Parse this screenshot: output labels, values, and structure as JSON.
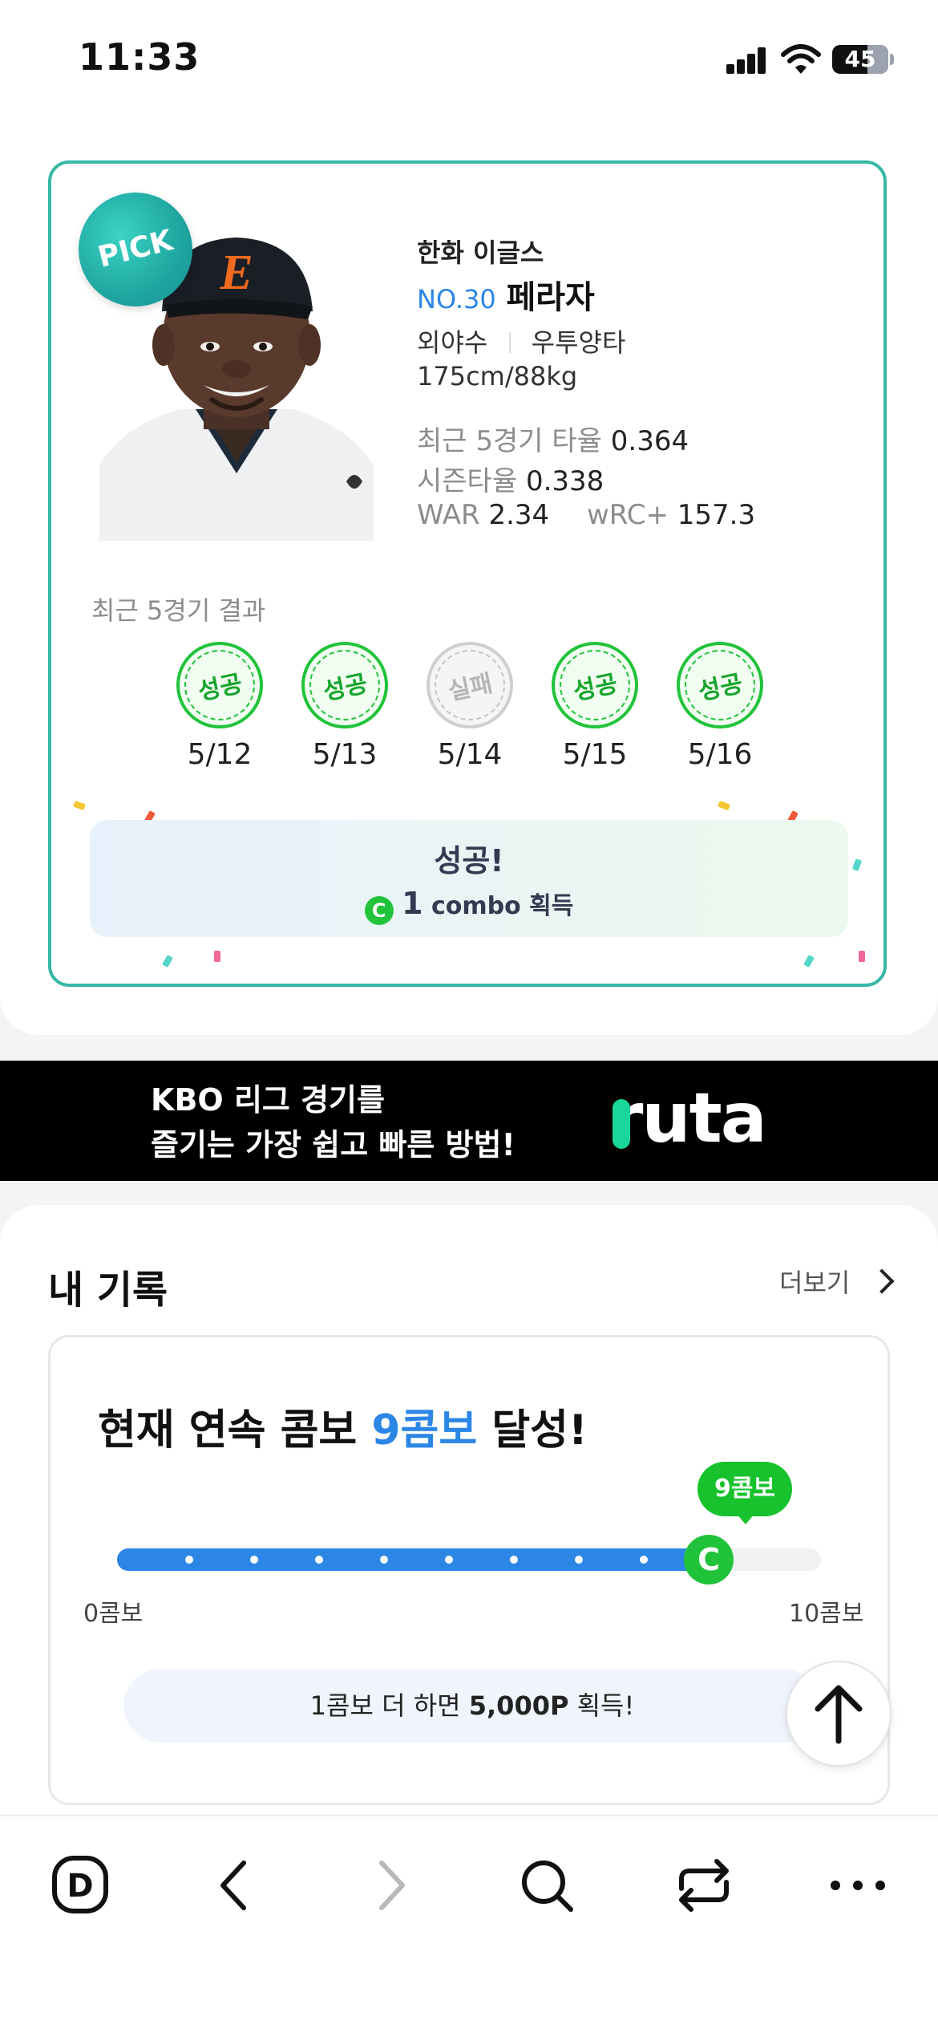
{
  "status_bar": {
    "time": "11:33",
    "battery": "45"
  },
  "player": {
    "badge": "PICK",
    "team": "한화 이글스",
    "number": "NO.30",
    "name": "페라자",
    "position": "외야수",
    "handedness": "우투양타",
    "body": "175cm/88kg",
    "stats": {
      "recent5_label": "최근 5경기 타율",
      "recent5_value": "0.364",
      "season_label": "시즌타율",
      "season_value": "0.338",
      "war_label": "WAR",
      "war_value": "2.34",
      "wrc_label": "wRC+",
      "wrc_value": "157.3"
    }
  },
  "recent_results": {
    "title": "최근 5경기 결과",
    "games": [
      {
        "result": "성공",
        "date": "5/12",
        "success": true
      },
      {
        "result": "성공",
        "date": "5/13",
        "success": true
      },
      {
        "result": "실패",
        "date": "5/14",
        "success": false
      },
      {
        "result": "성공",
        "date": "5/15",
        "success": true
      },
      {
        "result": "성공",
        "date": "5/16",
        "success": true
      }
    ]
  },
  "success_box": {
    "title": "성공!",
    "combo_count": "1",
    "combo_text": "combo 획득",
    "combo_icon": "C"
  },
  "ad": {
    "line1": "KBO 리그 경기를",
    "line2": "즐기는 가장 쉽고 빠른 방법!",
    "brand": "ruta"
  },
  "records": {
    "title": "내 기록",
    "more": "더보기",
    "combo_title_prefix": "현재 연속 콤보",
    "combo_highlight": "9콤보",
    "combo_title_suffix": "달성!",
    "tag": "9콤보",
    "marker_icon": "C",
    "min_label": "0콤보",
    "max_label": "10콤보",
    "progress_value": 9,
    "progress_max": 10,
    "reward_prefix": "1콤보 더 하면",
    "reward_points": "5,000P",
    "reward_suffix": "획득!"
  },
  "colors": {
    "card_border": "#37b8a5",
    "accent_blue": "#2b86e6",
    "accent_green": "#21c33a"
  },
  "toolbar_icons": [
    "home-d-icon",
    "back-icon",
    "forward-icon",
    "search-icon",
    "share-icon",
    "more-icon"
  ]
}
